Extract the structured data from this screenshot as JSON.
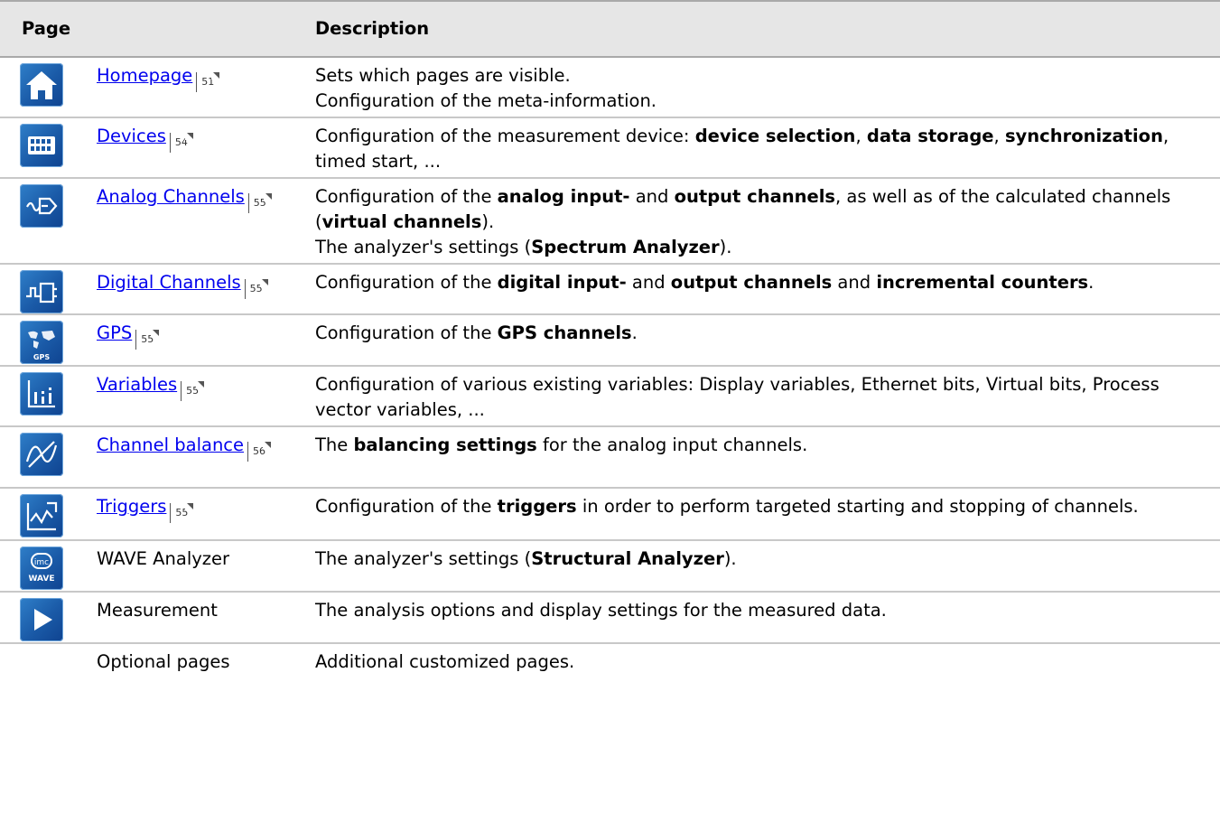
{
  "header": {
    "page": "Page",
    "description": "Description"
  },
  "rows": [
    {
      "icon": "home-icon",
      "page": "Homepage",
      "link": true,
      "ref": "51",
      "desc": [
        [
          {
            "t": "Sets which pages are visible."
          }
        ],
        [
          {
            "t": "Configuration of the meta-information."
          }
        ]
      ]
    },
    {
      "icon": "device-icon",
      "page": "Devices",
      "link": true,
      "ref": "54",
      "desc": [
        [
          {
            "t": "Configuration of the measurement device: "
          },
          {
            "t": "device selection",
            "b": true
          },
          {
            "t": ", "
          },
          {
            "t": "data storage",
            "b": true
          },
          {
            "t": ", "
          },
          {
            "t": "synchronization",
            "b": true
          },
          {
            "t": ", timed start, ..."
          }
        ]
      ]
    },
    {
      "icon": "analog-channels-icon",
      "page": "Analog Channels",
      "link": true,
      "ref": "55",
      "desc": [
        [
          {
            "t": "Configuration of the "
          },
          {
            "t": "analog input-",
            "b": true
          },
          {
            "t": " and "
          },
          {
            "t": "output channels",
            "b": true
          },
          {
            "t": ", as well as of the calculated channels ("
          },
          {
            "t": "virtual channels",
            "b": true
          },
          {
            "t": ")."
          }
        ],
        [
          {
            "t": "The analyzer's settings ("
          },
          {
            "t": "Spectrum Analyzer",
            "b": true
          },
          {
            "t": ")."
          }
        ]
      ]
    },
    {
      "icon": "digital-channels-icon",
      "page": "Digital Channels",
      "link": true,
      "ref": "55",
      "desc": [
        [
          {
            "t": "Configuration of the "
          },
          {
            "t": "digital input-",
            "b": true
          },
          {
            "t": " and "
          },
          {
            "t": "output channels",
            "b": true
          },
          {
            "t": " and "
          },
          {
            "t": "incremental counters",
            "b": true
          },
          {
            "t": "."
          }
        ]
      ]
    },
    {
      "icon": "gps-icon",
      "page": "GPS",
      "link": true,
      "ref": "55",
      "desc": [
        [
          {
            "t": "Configuration of the "
          },
          {
            "t": "GPS channels",
            "b": true
          },
          {
            "t": "."
          }
        ]
      ]
    },
    {
      "icon": "variables-icon",
      "page": "Variables",
      "link": true,
      "ref": "55",
      "desc": [
        [
          {
            "t": "Configuration of various existing variables: Display variables, Ethernet bits, Virtual bits, Process vector variables, ..."
          }
        ]
      ]
    },
    {
      "icon": "channel-balance-icon",
      "page": "Channel balance",
      "link": true,
      "ref": "56",
      "desc": [
        [
          {
            "t": "The "
          },
          {
            "t": "balancing settings",
            "b": true
          },
          {
            "t": " for the analog input channels."
          }
        ]
      ]
    },
    {
      "icon": "triggers-icon",
      "page": "Triggers",
      "link": true,
      "ref": "55",
      "desc": [
        [
          {
            "t": "Configuration of the "
          },
          {
            "t": "triggers",
            "b": true
          },
          {
            "t": " in order to perform targeted starting and stopping of channels."
          }
        ]
      ]
    },
    {
      "icon": "wave-analyzer-icon",
      "page": "WAVE Analyzer",
      "link": false,
      "ref": "",
      "desc": [
        [
          {
            "t": "The analyzer's settings ("
          },
          {
            "t": "Structural Analyzer",
            "b": true
          },
          {
            "t": ")."
          }
        ]
      ]
    },
    {
      "icon": "measurement-icon",
      "page": "Measurement",
      "link": false,
      "ref": "",
      "desc": [
        [
          {
            "t": "The analysis options and display settings for the measured data."
          }
        ]
      ]
    },
    {
      "icon": "",
      "page": "Optional pages",
      "link": false,
      "ref": "",
      "desc": [
        [
          {
            "t": "Additional customized pages."
          }
        ]
      ]
    }
  ],
  "icon_labels": {
    "gps": "GPS",
    "wave_top": "imc",
    "wave_bottom": "WAVE"
  },
  "colors": {
    "icon_blue": "#1a5aa7",
    "link": "#0000ee",
    "header_bg": "#e6e6e6"
  }
}
